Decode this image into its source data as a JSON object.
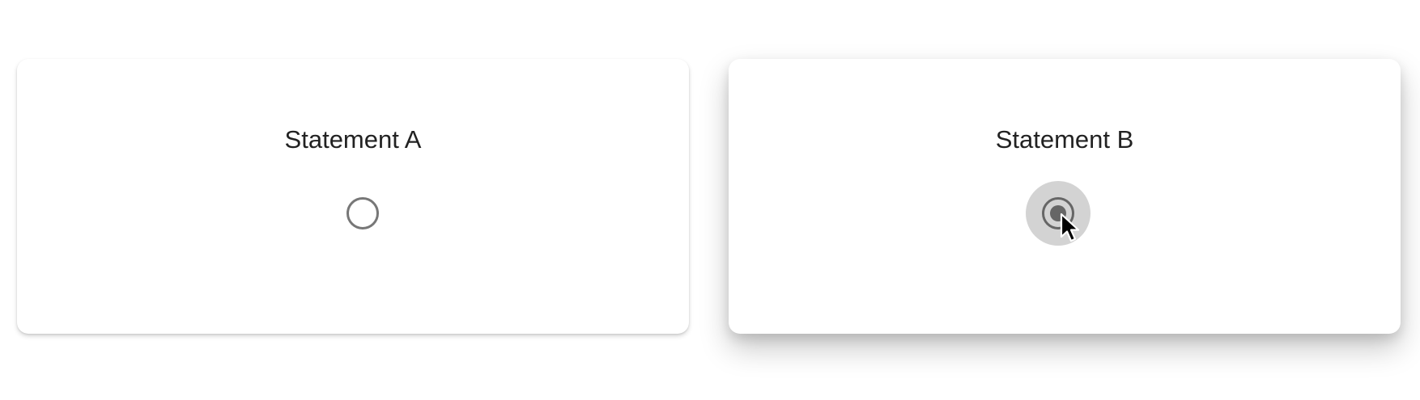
{
  "options": [
    {
      "label": "Statement A",
      "selected": false
    },
    {
      "label": "Statement B",
      "selected": true
    }
  ],
  "icons": {
    "radio_unchecked": "radio-unchecked-icon",
    "radio_checked": "radio-checked-icon",
    "cursor": "mouse-pointer-icon"
  },
  "colors": {
    "radio_border": "#777777",
    "radio_selected": "#666666",
    "hover_halo": "#d3d3d3",
    "text": "#222222"
  }
}
